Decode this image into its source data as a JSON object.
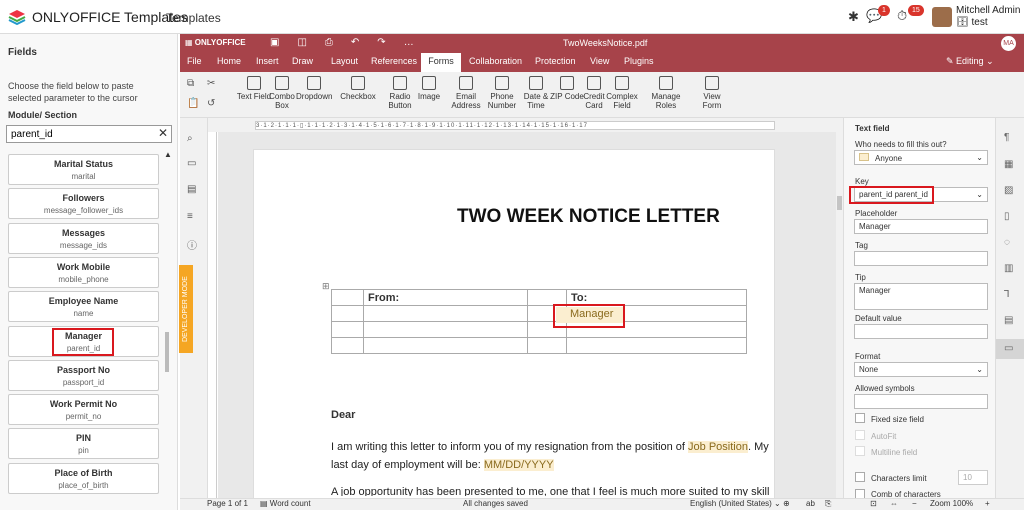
{
  "topbar": {
    "brand": "ONLYOFFICE Templates",
    "menu": "Templates",
    "chat_badge": "1",
    "activity_badge": "15",
    "user_name": "Mitchell Admin",
    "user_db": "test"
  },
  "left": {
    "title": "Fields",
    "hint": "Choose the field below to paste selected parameter to the cursor",
    "module_label": "Module/ Section",
    "search_value": "parent_id",
    "fields": [
      {
        "label": "Marital Status",
        "key": "marital"
      },
      {
        "label": "Followers",
        "key": "message_follower_ids"
      },
      {
        "label": "Messages",
        "key": "message_ids"
      },
      {
        "label": "Work Mobile",
        "key": "mobile_phone"
      },
      {
        "label": "Employee Name",
        "key": "name"
      },
      {
        "label": "Manager",
        "key": "parent_id"
      },
      {
        "label": "Passport No",
        "key": "passport_id"
      },
      {
        "label": "Work Permit No",
        "key": "permit_no"
      },
      {
        "label": "PIN",
        "key": "pin"
      },
      {
        "label": "Place of Birth",
        "key": "place_of_birth"
      }
    ]
  },
  "editor": {
    "logo": "ONLYOFFICE",
    "doc_title": "TwoWeeksNotice.pdf",
    "user_initials": "MA",
    "editing": "Editing",
    "tabs": [
      "File",
      "Home",
      "Insert",
      "Draw",
      "Layout",
      "References",
      "Forms",
      "Collaboration",
      "Protection",
      "View",
      "Plugins"
    ],
    "toolbar": [
      "Text Field",
      "Combo Box",
      "Dropdown",
      "Checkbox",
      "Radio Button",
      "Image",
      "Email Address",
      "Phone Number",
      "Date & Time",
      "ZIP Code",
      "Credit Card",
      "Complex Field",
      "Manage Roles",
      "View Form"
    ],
    "dev_mode": "DEVELOPER MODE"
  },
  "document": {
    "title": "TWO WEEK NOTICE LETTER",
    "from": "From:",
    "to": "To:",
    "manager_field": "Manager",
    "dear": "Dear",
    "para1_a": "I am writing this letter to inform you of my resignation from the position of ",
    "job_position": "Job Position",
    ".": ".",
    "para1_b": ". My last day of employment will be: ",
    "date": "MM/DD/YYYY",
    "para2": "A job opportunity has been presented to me, one that I feel is much more suited to my skill"
  },
  "rpanel": {
    "header": "Text field",
    "who_label": "Who needs to fill this out?",
    "who_value": "Anyone",
    "key_label": "Key",
    "key_value": "parent_id parent_id",
    "placeholder_label": "Placeholder",
    "placeholder_value": "Manager",
    "tag_label": "Tag",
    "tip_label": "Tip",
    "tip_value": "Manager",
    "default_label": "Default value",
    "format_label": "Format",
    "format_value": "None",
    "allowed_label": "Allowed symbols",
    "fixed": "Fixed size field",
    "autofit": "AutoFit",
    "multiline": "Multiline field",
    "charlimit": "Characters limit",
    "charlimit_value": "10",
    "comb": "Comb of characters"
  },
  "status": {
    "page": "Page 1 of 1",
    "word_count": "Word count",
    "saved": "All changes saved",
    "lang": "English (United States)",
    "zoom": "Zoom 100%"
  }
}
